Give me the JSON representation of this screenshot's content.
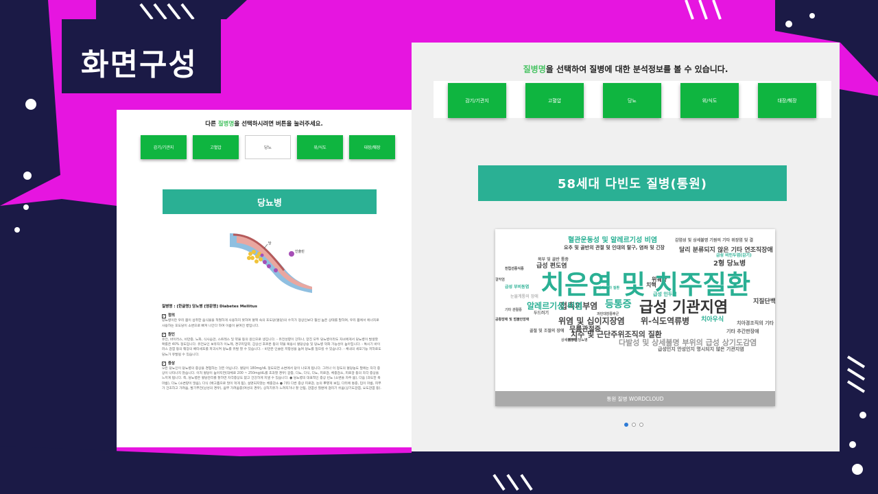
{
  "slide_title": "화면구성",
  "left_screen": {
    "instruction": {
      "prefix": "다른 ",
      "highlight": "질병명",
      "suffix": "을 선택하시려면 버튼을 눌러주세요."
    },
    "buttons": [
      "감기/기관지",
      "고혈압",
      "당뇨",
      "위/식도",
      "대장/췌장"
    ],
    "active_button_index": 2,
    "banner": "당뇨병",
    "illustration_labels": {
      "sugar": "당",
      "insulin": "인슐린"
    },
    "disease_name_line": "질병명 : [한글명] 당뇨병 [영문명] Diabetes Mellitus",
    "sections": [
      {
        "title": "정의",
        "body": "당뇨병이란 우리 몸이 섭취한 음식물을 적절하게 사용하지 못하여 혈액 속의 포도당(혈당)의 수치가 정상인보다 훨씬 높은 상태를 말하며, 우리 몸에서 에너지로 사용하는 포도당이 소변으로 빠져 나간다 하여 이름이 붙여진 병입니다."
      },
      {
        "title": "원인",
        "body": "유전, 바이러스, 비만증, 노화, 식사습관, 스트레스 및 약물 등의 원인으로 생깁니다. - 유전성향이 강하나, 양친 모두 당뇨병이라도 자녀에게서 당뇨병이 발생할 확률은 40% 정도입니다. 유전요인 보유자가 이뇨제, 경구피임약, 갑상선 호르몬 등의 약물 복용시 혈당상승 및 당뇨병 악화 가능성이 높아집니다. - 특시기 바이러스 감염 등의 췌장의 베타세포를 파괴시켜 당뇨를 유발 할 수 있습니다. - 비만은 인슐린 저항성을 높여 당뇨를 일으킬 수 있습니다. - 체내의 세포기능 저하로도 당뇨가 유발될 수 있습니다."
      },
      {
        "title": "증상",
        "body": "모든 당뇨인이 당뇨병의 증상을 경험하는 것은 아닙니다. 혈당이 180mg/dL 정도되면 소변에서 당이 나오게 됩니다. 그러나 이 정도의 혈당농도 말에는 자각 증상이 나타나지 않습니다. 이처 혈당이 높아지면(대체로 200 ~ 250mg/dL를 초과할 경우) 갈증, 다뇨, 다식, 다뇨, 피로감, 체중감소, 피로감 등의 자각 증상을 느끼게 됩니다. 즉, 당뇨병은 혈당관리를 잘하면 자각증상도 없고 건강하게 지낼 수 있습니다. ● 당뇨병의 대표적인 증상 빈뇨 (소변을 자주 봄), 다음 (과도한 목마름), 다뇨 (소변량이 많음), 다식 (배고픔으로 많이 먹게 됨), 설명되지않는 체중감소 ● 기타 다른 증상 피로감, 눈의 뿌옇게 보임, 다리에 통증, 입이 마름, 피부가 건조하고 가려움, 발기부전(남성의 경우), 음부 가려움증(여성의 경우), 상처치유가 느려지거나 잘 안됨, 감염성 질환에 걸리기 쉬움(상기도감염, 요도감염 등)."
      }
    ]
  },
  "right_screen": {
    "instruction": {
      "highlight": "질병명",
      "suffix": "을 선택하여 질병에 대한 분석정보를 볼 수 있습니다."
    },
    "buttons": [
      "감기/기관지",
      "고혈압",
      "당뇨",
      "위/식도",
      "대장/췌장"
    ],
    "banner": "58세대 다빈도 질병(통원)",
    "wordcloud_caption": "통원 질병 WORDCLOUD",
    "carousel_dots": 3,
    "carousel_active": 0,
    "wordcloud": [
      {
        "text": "치은염 및 치주질환",
        "color": "#2ab094"
      },
      {
        "text": "급성 기관지염",
        "color": "#333333"
      },
      {
        "text": "등통증",
        "color": "#2ab094"
      },
      {
        "text": "접촉피부염",
        "color": "#444444"
      },
      {
        "text": "알레르기성 비염",
        "color": "#2ab094"
      },
      {
        "text": "위염 및 십이지장염",
        "color": "#444444"
      },
      {
        "text": "위-식도역류병",
        "color": "#444444"
      },
      {
        "text": "치수 및 근단주위조직의 질환",
        "color": "#444444"
      },
      {
        "text": "다발성 및 상세불명 부위의 급성 상기도감염",
        "color": "#999999"
      },
      {
        "text": "혈관운동성 및 알레르기성 비염",
        "color": "#2ab094"
      },
      {
        "text": "요추 및 골반의 관절 및 인대의 탈구, 염좌 및 긴장",
        "color": "#444444"
      },
      {
        "text": "달리 분류되지 않은 기타 연조직장애",
        "color": "#444444"
      },
      {
        "text": "감염성 및 상세불명 기원의 기타 위장염 및 결",
        "color": "#666666"
      },
      {
        "text": "급성 비인두염(감기)",
        "color": "#2ab094"
      },
      {
        "text": "2형 당뇨병",
        "color": "#444444"
      },
      {
        "text": "급성 편도염",
        "color": "#444444"
      },
      {
        "text": "무릎관절증",
        "color": "#444444"
      },
      {
        "text": "치아우식",
        "color": "#2ab094"
      },
      {
        "text": "지질단백",
        "color": "#444444"
      },
      {
        "text": "치아경조직의 기타",
        "color": "#666666"
      },
      {
        "text": "기타 추간판장애",
        "color": "#666666"
      },
      {
        "text": "급성인지 안성인지 명시되지 않은 기관지염",
        "color": "#666666"
      },
      {
        "text": "목부 및 골반 통증",
        "color": "#666666"
      },
      {
        "text": "급성 부비동염",
        "color": "#2ab094"
      },
      {
        "text": "눈물계통의 장애",
        "color": "#bbbbbb"
      },
      {
        "text": "두드러기",
        "color": "#666666"
      },
      {
        "text": "과민대장증후군",
        "color": "#666666"
      },
      {
        "text": "골절 및 조절의 장애",
        "color": "#666666"
      },
      {
        "text": "상세불명의 당뇨병",
        "color": "#666666"
      },
      {
        "text": "기타 관절증",
        "color": "#666666"
      },
      {
        "text": "결막염",
        "color": "#666666"
      },
      {
        "text": "급성 인두염",
        "color": "#2ab094"
      },
      {
        "text": "전립선증식증",
        "color": "#444444"
      },
      {
        "text": "피부염",
        "color": "#444444"
      },
      {
        "text": "위궤양",
        "color": "#444444"
      },
      {
        "text": "상의 기타 질환",
        "color": "#2ab094"
      },
      {
        "text": "치핵",
        "color": "#444444"
      },
      {
        "text": "공황장애 및 범불안장애",
        "color": "#444444"
      }
    ]
  },
  "colors": {
    "background": "#e615e0",
    "navy": "#1b1a46",
    "button_green": "#0fb540",
    "banner_teal": "#2ab094",
    "highlight_green": "#49c364"
  }
}
